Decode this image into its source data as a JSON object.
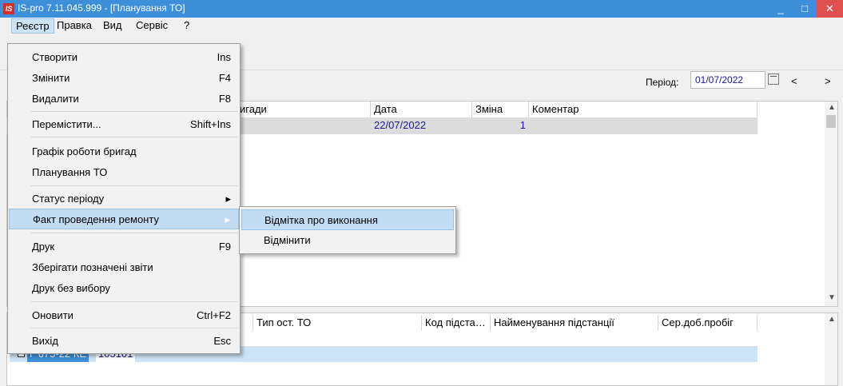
{
  "window": {
    "title": "IS-pro 7.11.045.999 - [Планування ТО]",
    "logo": "IS",
    "min": "_",
    "max": "□",
    "close": "✕"
  },
  "menubar": [
    "Реєстр",
    "Правка",
    "Вид",
    "Сервіс",
    "?"
  ],
  "period": {
    "label": "Період:",
    "value": "01/07/2022",
    "prev": "<",
    "next": ">"
  },
  "top_grid": {
    "columns": [
      "игади",
      "Дата",
      "Зміна",
      "Коментар"
    ],
    "rows": [
      {
        "date": "22/07/2022",
        "shift": "1",
        "comment": ""
      }
    ]
  },
  "bottom_grid": {
    "columns": [
      "Тип ост. ТО",
      "Код підста…",
      "Найменування підстанції",
      "Сер.доб.пробіг"
    ],
    "row_code": "Г 675-22 КЕ",
    "row_id": "105101"
  },
  "dropdown": {
    "items": [
      {
        "label": "Створити",
        "shortcut": "Ins"
      },
      {
        "label": "Змінити",
        "shortcut": "F4"
      },
      {
        "label": "Видалити",
        "shortcut": "F8"
      },
      {
        "label": "Перемістити...",
        "shortcut": "Shift+Ins"
      },
      {
        "label": "Графік роботи бригад",
        "shortcut": ""
      },
      {
        "label": "Планування ТО",
        "shortcut": ""
      },
      {
        "label": "Статус періоду",
        "shortcut": "▸"
      },
      {
        "label": "Факт проведення ремонту",
        "shortcut": "▸"
      },
      {
        "label": "Друк",
        "shortcut": "F9"
      },
      {
        "label": "Зберігати позначені звіти",
        "shortcut": ""
      },
      {
        "label": "Друк без вибору",
        "shortcut": ""
      },
      {
        "label": "Оновити",
        "shortcut": "Ctrl+F2"
      },
      {
        "label": "Вихід",
        "shortcut": "Esc"
      }
    ]
  },
  "submenu": {
    "items": [
      "Відмітка про виконання",
      "Відмінити"
    ]
  },
  "colors": {
    "titlebar": "#3c8fd8",
    "highlight": "#c2dcf4",
    "close": "#e05050"
  }
}
